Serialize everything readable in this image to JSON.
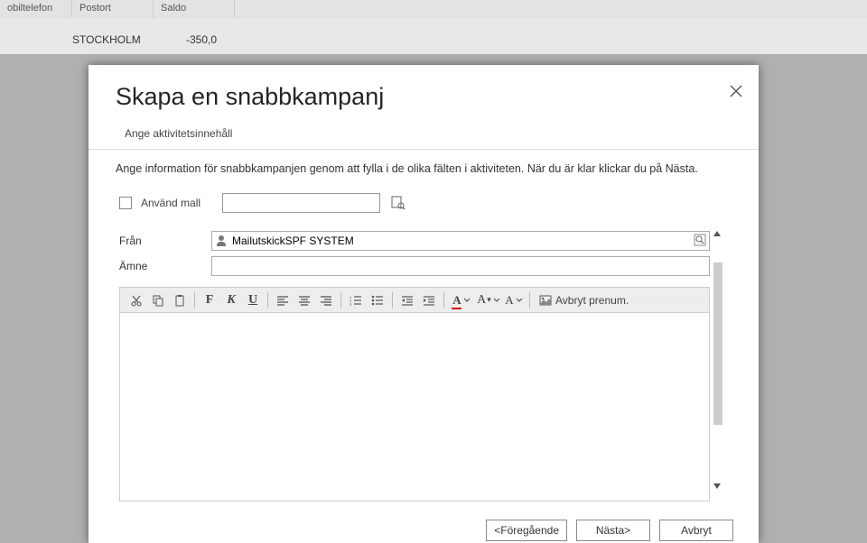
{
  "bg": {
    "headers": {
      "tel": "obiltelefon",
      "postort": "Postort",
      "saldo": "Saldo"
    },
    "row": {
      "postort": "STOCKHOLM",
      "saldo": "-350,0"
    }
  },
  "dialog": {
    "title": "Skapa en snabbkampanj",
    "step_label": "Ange aktivitetsinnehåll",
    "instruction": "Ange information för snabbkampanjen genom att fylla i de olika fälten i aktiviteten. När du är klar klickar du på Nästa.",
    "use_template_label": "Använd mall",
    "fields": {
      "from_label": "Från",
      "from_value": "MailutskickSPF SYSTEM",
      "subject_label": "Ämne",
      "subject_value": ""
    },
    "toolbar": {
      "bold": "F",
      "italic": "K",
      "underline": "U",
      "font_color": "A",
      "font_size": "A",
      "font_family": "A",
      "unsubscribe": "Avbryt prenum."
    },
    "buttons": {
      "prev": "<Föregående",
      "next": "Nästa>",
      "cancel": "Avbryt"
    }
  }
}
